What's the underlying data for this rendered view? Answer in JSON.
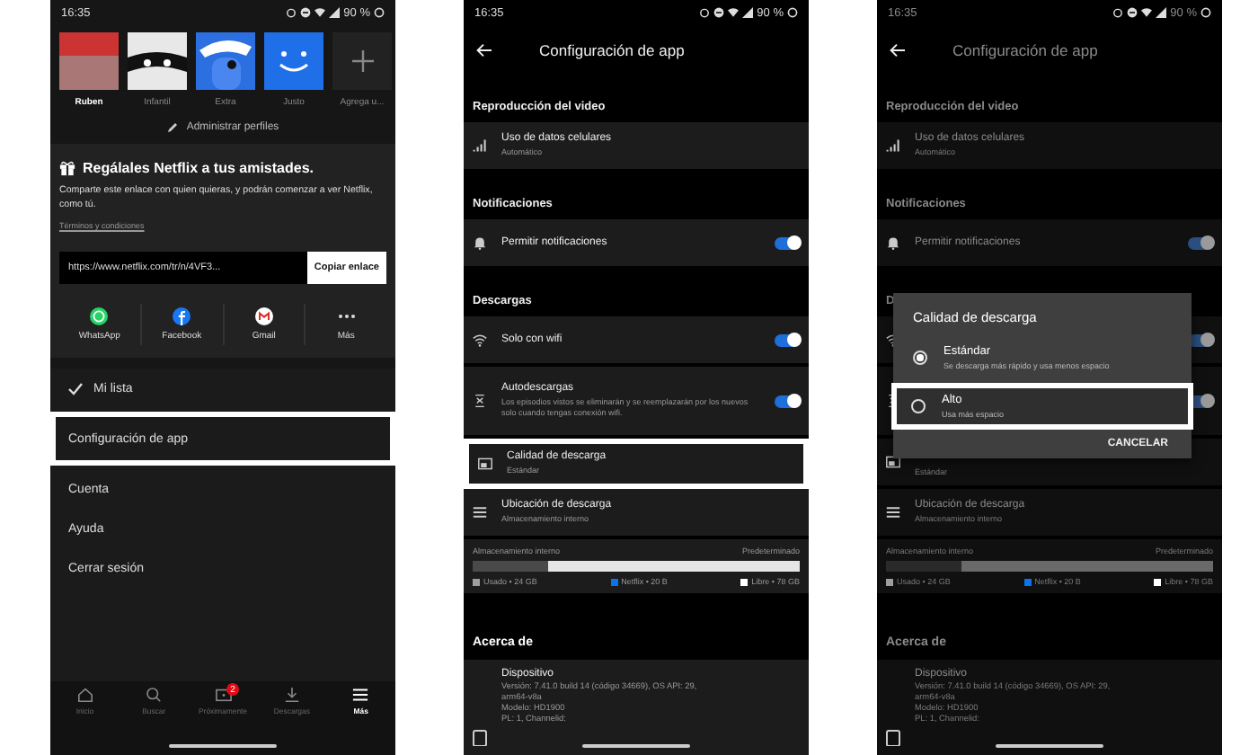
{
  "screens": [
    {
      "kind": "menu",
      "status_bar": {
        "time": "16:35",
        "battery": "90 %"
      },
      "profiles": [
        {
          "name": "Ruben",
          "kind": "photo",
          "selected": true
        },
        {
          "name": "Infantil",
          "kind": "kids",
          "selected": false
        },
        {
          "name": "Extra",
          "kind": "pirate",
          "selected": false
        },
        {
          "name": "Justo",
          "kind": "smile",
          "selected": false
        },
        {
          "name": "Agrega u...",
          "kind": "add",
          "selected": false
        }
      ],
      "manage_profiles": "Administrar perfiles",
      "gift": {
        "title": "Regálales Netflix a tus amistades.",
        "description": "Comparte este enlace con quien quieras, y podrán comenzar a ver Netflix, como tú.",
        "terms": "Términos y condiciones",
        "url": "https://www.netflix.com/tr/n/4VF3...",
        "copy_button": "Copiar enlace",
        "share": [
          {
            "label": "WhatsApp",
            "kind": "whatsapp"
          },
          {
            "label": "Facebook",
            "kind": "facebook"
          },
          {
            "label": "Gmail",
            "kind": "gmail"
          },
          {
            "label": "Más",
            "kind": "more"
          }
        ]
      },
      "menu": [
        {
          "label": "Mi lista",
          "kind": "check",
          "highlighted": false
        },
        {
          "label": "Configuración de app",
          "kind": "plain",
          "highlighted": true
        },
        {
          "label": "Cuenta",
          "kind": "plain",
          "highlighted": false
        },
        {
          "label": "Ayuda",
          "kind": "plain",
          "highlighted": false
        },
        {
          "label": "Cerrar sesión",
          "kind": "plain",
          "highlighted": false
        }
      ],
      "nav": [
        {
          "label": "Inicio",
          "kind": "home",
          "selected": false
        },
        {
          "label": "Buscar",
          "kind": "search",
          "selected": false
        },
        {
          "label": "Próximamente",
          "kind": "upcoming",
          "selected": false,
          "badge": "2"
        },
        {
          "label": "Descargas",
          "kind": "download",
          "selected": false
        },
        {
          "label": "Más",
          "kind": "more",
          "selected": true
        }
      ]
    },
    {
      "kind": "settings",
      "status_bar": {
        "time": "16:35",
        "battery": "90 %"
      },
      "title": "Configuración de app",
      "sections": [
        {
          "title": "Reproducción del video",
          "rows": [
            {
              "kind": "signal",
              "title": "Uso de datos celulares",
              "subtitle": "Automático",
              "highlighted": false
            }
          ]
        },
        {
          "title": "Notificaciones",
          "rows": [
            {
              "kind": "bell",
              "title": "Permitir notificaciones",
              "on": true,
              "highlighted": false
            }
          ]
        },
        {
          "title": "Descargas",
          "rows": [
            {
              "kind": "wifi",
              "title": "Solo con wifi",
              "on": true,
              "highlighted": false
            },
            {
              "kind": "auto",
              "title": "Autodescargas",
              "subtitle": "Los episodios vistos se eliminarán y se reemplazarán por los nuevos solo cuando tengas conexión wifi.",
              "on": true,
              "highlighted": false
            },
            {
              "kind": "quality",
              "title": "Calidad de descarga",
              "subtitle": "Estándar",
              "highlighted": true
            },
            {
              "kind": "list",
              "title": "Ubicación de descarga",
              "subtitle": "Almacenamiento interno",
              "highlighted": false
            }
          ]
        }
      ],
      "storage": {
        "label": "Almacenamiento interno",
        "default_label": "Predeterminado",
        "level": 0.23,
        "legend": [
          {
            "label": "Usado • 24 GB",
            "color": "#9e9e9e"
          },
          {
            "label": "Netflix • 20 B",
            "color": "#0a74e8"
          },
          {
            "label": "Libre • 78 GB",
            "color": "#ffffff"
          }
        ]
      },
      "about": {
        "title": "Acerca de",
        "device": {
          "title": "Dispositivo",
          "lines": [
            "Versión: 7.41.0 build 14 (código 34669), OS API: 29,",
            "arm64-v8a",
            "Modelo: HD1900",
            "PL: 1, Channelid:"
          ]
        }
      }
    },
    {
      "kind": "settings",
      "status_bar": {
        "time": "16:35",
        "battery": "90 %"
      },
      "title": "Configuración de app",
      "sections": [
        {
          "title": "Reproducción del video",
          "rows": [
            {
              "kind": "signal",
              "title": "Uso de datos celulares",
              "subtitle": "Automático",
              "highlighted": false
            }
          ]
        },
        {
          "title": "Notificaciones",
          "rows": [
            {
              "kind": "bell",
              "title": "Permitir notificaciones",
              "on": true,
              "highlighted": false
            }
          ]
        },
        {
          "title": "D",
          "rows": [
            {
              "kind": "wifi",
              "on": true,
              "highlighted": false
            },
            {
              "kind": "auto",
              "on": true,
              "highlighted": false
            },
            {
              "kind": "quality",
              "subtitle": "Estándar",
              "highlighted": false
            },
            {
              "kind": "list",
              "title": "Ubicación de descarga",
              "subtitle": "Almacenamiento interno",
              "highlighted": false
            }
          ]
        }
      ],
      "storage": {
        "label": "Almacenamiento interno",
        "default_label": "Predeterminado",
        "level": 0.23,
        "legend": [
          {
            "label": "Usado • 24 GB",
            "color": "#9e9e9e"
          },
          {
            "label": "Netflix • 20 B",
            "color": "#0a74e8"
          },
          {
            "label": "Libre • 78 GB",
            "color": "#ffffff"
          }
        ]
      },
      "about": {
        "title": "Acerca de",
        "device": {
          "title": "Dispositivo",
          "lines": [
            "Versión: 7.41.0 build 14 (código 34669), OS API: 29,",
            "arm64-v8a",
            "Modelo: HD1900",
            "PL: 1, Channelid:"
          ]
        }
      },
      "dialog": {
        "title": "Calidad de descarga",
        "cancel": "CANCELAR",
        "options": [
          {
            "label": "Estándar",
            "description": "Se descarga más rápido y usa menos espacio",
            "selected": true,
            "highlighted": false
          },
          {
            "label": "Alto",
            "description": "Usa más espacio",
            "selected": false,
            "highlighted": true
          }
        ]
      }
    }
  ]
}
